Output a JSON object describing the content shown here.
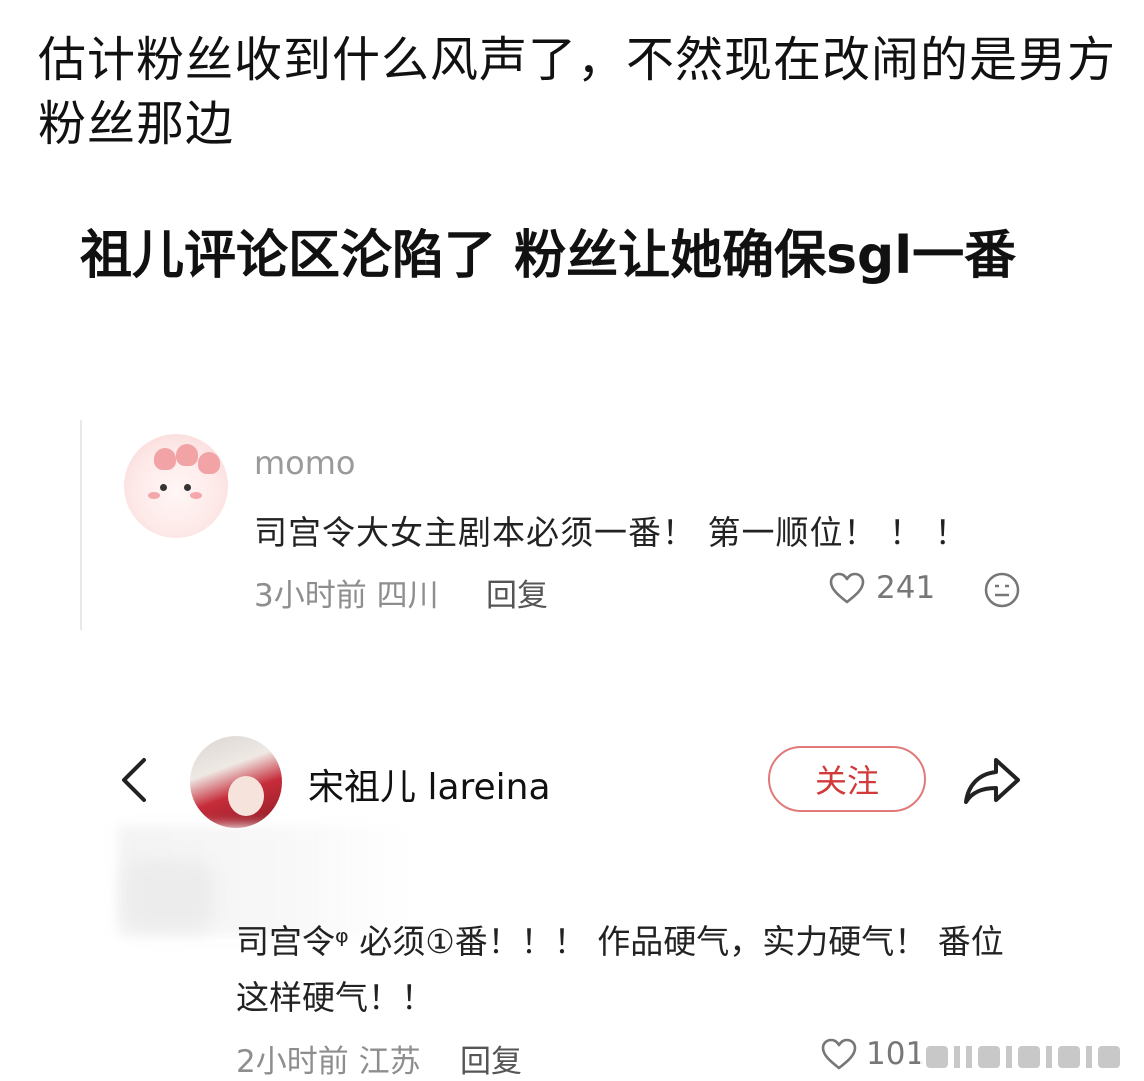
{
  "post": {
    "caption": "估计粉丝收到什么风声了，不然现在改闹的是男方粉丝那边",
    "title": "祖儿评论区沦陷了 粉丝让她确保sgl一番"
  },
  "comment1": {
    "username": "momo",
    "text": "司宫令大女主剧本必须一番！ 第一顺位！ ！ ！",
    "meta": "3小时前 四川",
    "reply_label": "回复",
    "likes": "241"
  },
  "profile": {
    "name": "宋祖儿 lareina",
    "follow_label": "关注"
  },
  "comment2": {
    "text": "司宫令ᵠ 必须①番！！！ 作品硬气，实力硬气！ 番位这样硬气！！",
    "meta": "2小时前 江苏",
    "reply_label": "回复",
    "likes": "101"
  },
  "colors": {
    "follow_accent": "#d23b3b",
    "follow_border": "#e07a7a",
    "muted_text": "#8e8e8e"
  },
  "icons": {
    "back": "chevron-left-icon",
    "share": "share-arrow-icon",
    "like": "heart-outline-icon",
    "emoji": "smiley-icon"
  }
}
